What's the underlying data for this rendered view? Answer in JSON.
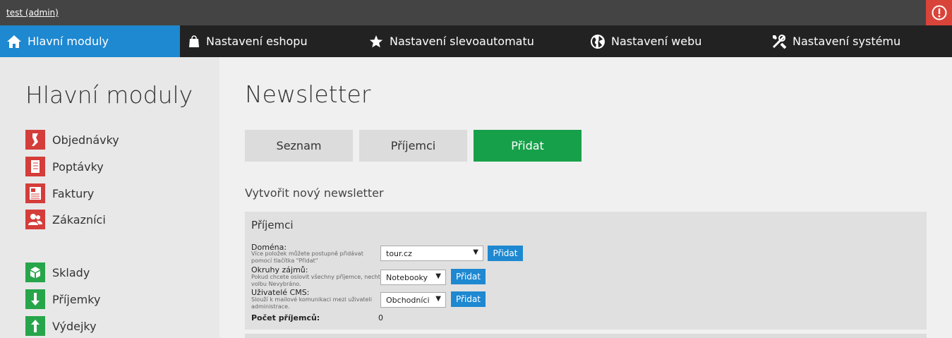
{
  "topbar": {
    "user": "test (admin)"
  },
  "nav": {
    "items": [
      {
        "label": "Hlavní moduly",
        "icon": "home-icon",
        "active": true
      },
      {
        "label": "Nastavení eshopu",
        "icon": "shopping-bag-icon"
      },
      {
        "label": "Nastavení slevoautomatu",
        "icon": "star-icon"
      },
      {
        "label": "Nastavení webu",
        "icon": "globe-icon"
      },
      {
        "label": "Nastavení systému",
        "icon": "tools-icon"
      }
    ]
  },
  "sidebar": {
    "title": "Hlavní moduly",
    "items": [
      {
        "label": "Objednávky",
        "icon": "order-icon",
        "color": "#d43d3a"
      },
      {
        "label": "Poptávky",
        "icon": "notebook-icon",
        "color": "#d43d3a"
      },
      {
        "label": "Faktury",
        "icon": "invoice-icon",
        "color": "#d43d3a"
      },
      {
        "label": "Zákazníci",
        "icon": "users-icon",
        "color": "#d43d3a"
      },
      {
        "label": "Sklady",
        "icon": "boxes-icon",
        "color": "#27a54a"
      },
      {
        "label": "Příjemky",
        "icon": "arrow-down-icon",
        "color": "#27a54a"
      },
      {
        "label": "Výdejky",
        "icon": "arrow-up-icon",
        "color": "#27a54a"
      }
    ]
  },
  "main": {
    "title": "Newsletter",
    "tabs": [
      {
        "label": "Seznam",
        "active": false
      },
      {
        "label": "Příjemci",
        "active": false
      },
      {
        "label": "Přidat",
        "active": true
      }
    ],
    "subtitle": "Vytvořit nový newsletter",
    "panel": {
      "title": "Příjemci",
      "rows": [
        {
          "label": "Doména:",
          "hint": "Více položek můžete postupně přidávat pomocí tlačítka \"Přidat\"",
          "value": "tour.cz",
          "button": "Přidat"
        },
        {
          "label": "Okruhy zájmů:",
          "hint": "Pokud chcete oslovit všechny příjemce, nechte volbu Nevybráno.",
          "value": "Notebooky",
          "button": "Přidat"
        },
        {
          "label": "Uživatelé CMS:",
          "hint": "Slouží k mailové komunikaci mezi uživateli administrace.",
          "value": "Obchodníci",
          "button": "Přidat"
        }
      ],
      "count_label": "Počet příjemců:",
      "count_value": "0"
    }
  },
  "colors": {
    "accent": "#1e88d1",
    "success": "#17a04a",
    "danger": "#d9443a"
  }
}
